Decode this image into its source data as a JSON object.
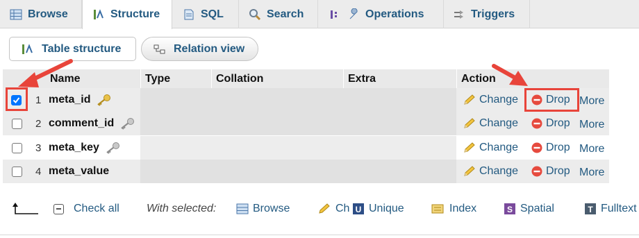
{
  "tabs": [
    {
      "label": "Browse",
      "icon": "table-icon"
    },
    {
      "label": "Structure",
      "icon": "structure-icon",
      "active": true
    },
    {
      "label": "SQL",
      "icon": "sql-icon"
    },
    {
      "label": "Search",
      "icon": "search-icon"
    },
    {
      "label": "Operations",
      "icon": "wrench-icon"
    },
    {
      "label": "Triggers",
      "icon": "triggers-icon"
    }
  ],
  "subnav": {
    "table_structure": "Table structure",
    "relation_view": "Relation view"
  },
  "columns": {
    "name": "Name",
    "type": "Type",
    "collation": "Collation",
    "extra": "Extra",
    "action": "Action"
  },
  "rows": [
    {
      "num": "1",
      "name": "meta_id",
      "checked": true,
      "key": "primary"
    },
    {
      "num": "2",
      "name": "comment_id",
      "checked": false,
      "key": "index"
    },
    {
      "num": "3",
      "name": "meta_key",
      "checked": false,
      "key": "index"
    },
    {
      "num": "4",
      "name": "meta_value",
      "checked": false,
      "key": "none"
    }
  ],
  "actions": {
    "change": "Change",
    "drop": "Drop",
    "more": "More"
  },
  "footer": {
    "check_all": "Check all",
    "with_selected": "With selected:",
    "browse": "Browse",
    "change_truncated": "Ch",
    "unique": "Unique",
    "index": "Index",
    "spatial": "Spatial",
    "fulltext": "Fulltext"
  },
  "colors": {
    "link": "#235a81",
    "annotation": "#e8443a",
    "checkbox_checked": "#0075ff"
  }
}
